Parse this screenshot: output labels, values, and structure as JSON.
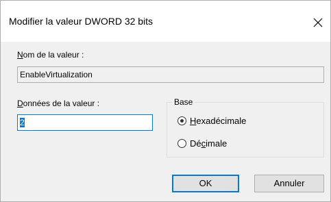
{
  "window": {
    "title": "Modifier la valeur DWORD 32 bits",
    "close_glyph": "×"
  },
  "value_name": {
    "label_first": "N",
    "label_rest": "om de la valeur :",
    "value": "EnableVirtualization"
  },
  "value_data": {
    "label_first": "D",
    "label_rest": "onnées de la valeur :",
    "value": "2"
  },
  "base": {
    "legend": "Base",
    "options": [
      {
        "pre": "",
        "mnemonic": "H",
        "post": "exadécimale",
        "selected": true
      },
      {
        "pre": "Dé",
        "mnemonic": "c",
        "post": "imale",
        "selected": false
      }
    ]
  },
  "buttons": {
    "ok": "OK",
    "cancel": "Annuler"
  },
  "colors": {
    "accent": "#0078d7",
    "button_face": "#e1e1e1",
    "dialog_bg": "#f0f0f0"
  }
}
